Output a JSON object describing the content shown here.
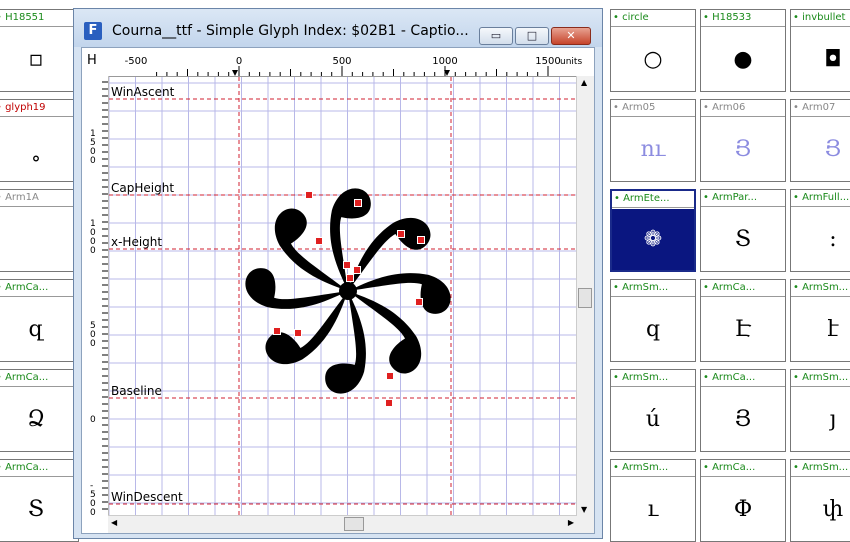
{
  "window": {
    "title": "Courna__ttf - Simple Glyph Index: $02B1 - Captio...",
    "icon_letter": "F",
    "min_label": "▭",
    "max_label": "□",
    "close_label": "✕"
  },
  "ruler": {
    "h_prefix": "H",
    "h_labels": [
      "-500",
      "0",
      "500",
      "1000",
      "1500"
    ],
    "units_label": "units",
    "v_labels": [
      {
        "text": "1\n5\n0\n0"
      },
      {
        "text": "1\n0\n0\n0"
      },
      {
        "text": "5\n0\n0"
      },
      {
        "text": "0"
      },
      {
        "text": "-\n5\n0\n0"
      }
    ]
  },
  "guidelines": {
    "win_ascent": "WinAscent",
    "cap_height": "CapHeight",
    "x_height": "x-Height",
    "baseline": "Baseline",
    "win_descent": "WinDescent"
  },
  "left_cells": [
    {
      "label": "H18551",
      "color": "#1a8a1a",
      "glyph": "▫"
    },
    {
      "label": "glyph19",
      "color": "#c00000",
      "glyph": "˳"
    },
    {
      "label": "Arm1A",
      "color": "#888888",
      "glyph": ""
    },
    {
      "label": "ArmCa...",
      "color": "#1a8a1a",
      "glyph": "զ"
    },
    {
      "label": "ArmCa...",
      "color": "#1a8a1a",
      "glyph": "Ձ"
    },
    {
      "label": "ArmCa...",
      "color": "#1a8a1a",
      "glyph": "Տ"
    }
  ],
  "right_cells": [
    [
      {
        "label": "circle",
        "color": "#1a8a1a",
        "glyph": "○"
      },
      {
        "label": "H18533",
        "color": "#1a8a1a",
        "glyph": "●"
      },
      {
        "label": "invbullet",
        "color": "#1a8a1a",
        "glyph": "◘"
      }
    ],
    [
      {
        "label": "Arm05",
        "color": "#888888",
        "glyph": "ու"
      },
      {
        "label": "Arm06",
        "color": "#888888",
        "glyph": "Յ"
      },
      {
        "label": "Arm07",
        "color": "#888888",
        "glyph": "Յ"
      }
    ],
    [
      {
        "label": "ArmEte...",
        "color": "#1a8a1a",
        "glyph": "❁",
        "selected": true
      },
      {
        "label": "ArmPar...",
        "color": "#1a8a1a",
        "glyph": "Տ"
      },
      {
        "label": "ArmFull...",
        "color": "#1a8a1a",
        "glyph": ":"
      }
    ],
    [
      {
        "label": "ArmSm...",
        "color": "#1a8a1a",
        "glyph": "q"
      },
      {
        "label": "ArmCa...",
        "color": "#1a8a1a",
        "glyph": "Է"
      },
      {
        "label": "ArmSm...",
        "color": "#1a8a1a",
        "glyph": "է"
      }
    ],
    [
      {
        "label": "ArmSm...",
        "color": "#1a8a1a",
        "glyph": "ú"
      },
      {
        "label": "ArmCa...",
        "color": "#1a8a1a",
        "glyph": "Յ"
      },
      {
        "label": "ArmSm...",
        "color": "#1a8a1a",
        "glyph": "յ"
      }
    ],
    [
      {
        "label": "ArmSm...",
        "color": "#1a8a1a",
        "glyph": "ւ"
      },
      {
        "label": "ArmCa...",
        "color": "#1a8a1a",
        "glyph": "Փ"
      },
      {
        "label": "ArmSm...",
        "color": "#1a8a1a",
        "glyph": "փ"
      }
    ]
  ],
  "colors": {
    "grid": "#b8b8e8",
    "guideline": "#d02030",
    "point": "#e02020",
    "selection": "#0a1680"
  }
}
